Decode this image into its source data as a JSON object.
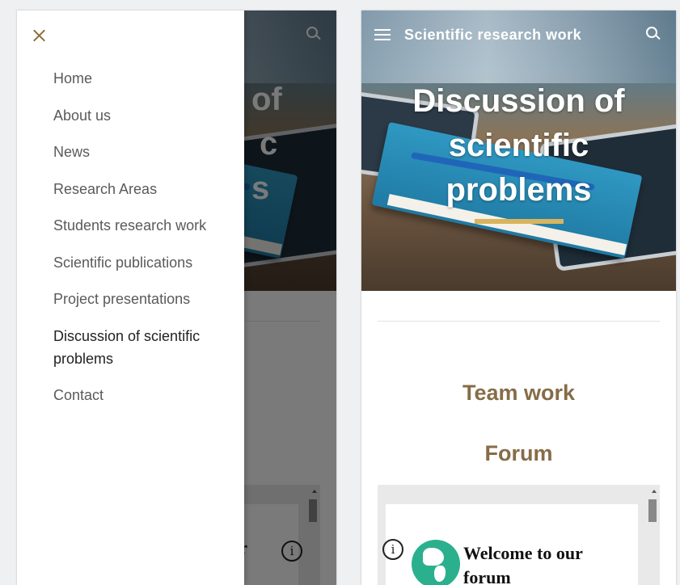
{
  "site": {
    "title": "Scientific research work"
  },
  "hero": {
    "title_line1": "Discussion of",
    "title_line2": "scientific",
    "title_line3": "problems"
  },
  "section": {
    "heading1": "Team work",
    "heading2": "Forum"
  },
  "embed": {
    "welcome_line1": "Welcome to our",
    "welcome_line2": "forum",
    "info_glyph": "i"
  },
  "drawer": {
    "close_glyph": "×",
    "items": [
      {
        "label": "Home"
      },
      {
        "label": "About us"
      },
      {
        "label": "News"
      },
      {
        "label": "Research Areas"
      },
      {
        "label": "Students research work"
      },
      {
        "label": "Scientific publications"
      },
      {
        "label": "Project presentations"
      },
      {
        "label": "Discussion of scientific problems"
      },
      {
        "label": "Contact"
      }
    ],
    "active_index": 7
  },
  "ghost": {
    "title_fragment1": "of",
    "title_fragment2": "c",
    "title_fragment3": "s",
    "forum_fragment": "ur"
  },
  "colors": {
    "accent": "#866c48",
    "underline": "#d9b45c",
    "globe": "#2bb08d"
  },
  "icons": [
    "menu-icon",
    "search-icon",
    "close-icon",
    "info-icon",
    "globe-icon"
  ]
}
